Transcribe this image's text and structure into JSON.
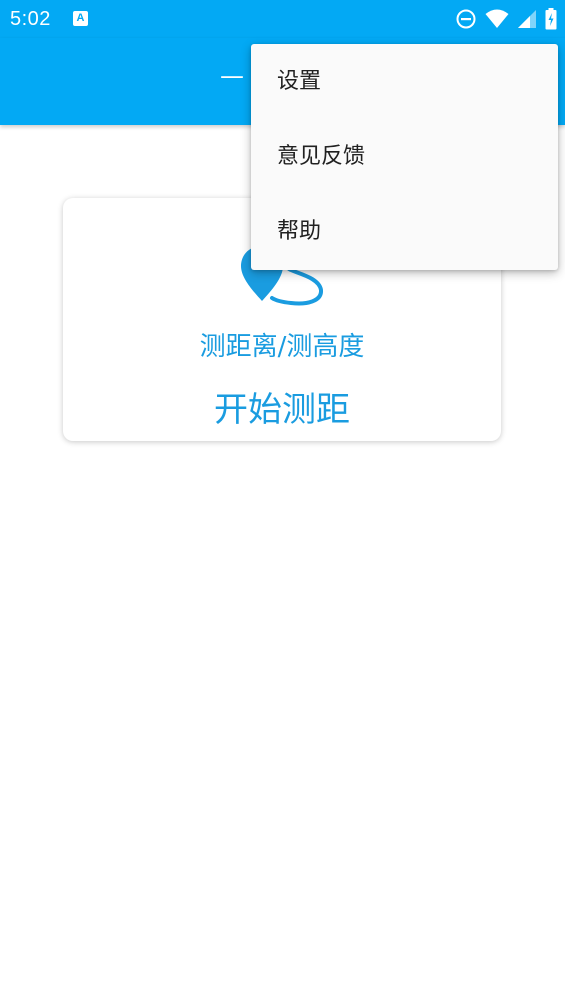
{
  "status_bar": {
    "time": "5:02",
    "notification_glyph": "A",
    "icons": [
      "dnd-icon",
      "wifi-icon",
      "cell-signal-icon",
      "battery-charging-icon"
    ]
  },
  "app_bar": {
    "title": "—"
  },
  "card": {
    "icon": "location-route-icon",
    "subtitle": "测距离/测高度",
    "action_label": "开始测距"
  },
  "menu": {
    "items": [
      {
        "label": "设置"
      },
      {
        "label": "意见反馈"
      },
      {
        "label": "帮助"
      }
    ]
  },
  "colors": {
    "primary": "#03A9F4",
    "accent_text": "#1A9CE0",
    "menu_bg": "#FAFAFA",
    "menu_text": "#212121"
  }
}
